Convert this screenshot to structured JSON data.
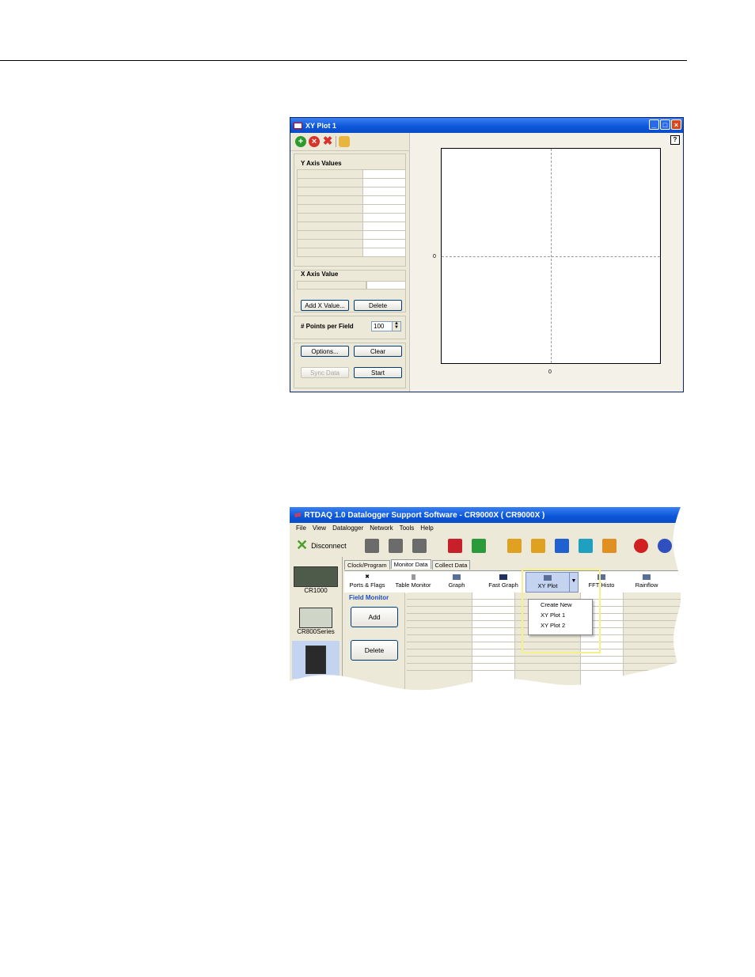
{
  "xy_window": {
    "title": "XY Plot 1",
    "toolbar_icons": [
      "add-icon",
      "remove-icon",
      "delete-icon",
      "hand-icon"
    ],
    "y_axis_label": "Y Axis Values",
    "x_axis_label": "X Axis Value",
    "add_x_value_button": "Add X Value...",
    "delete_button": "Delete",
    "points_per_field_label": "# Points per Field",
    "points_per_field_value": "100",
    "options_button": "Options...",
    "clear_button": "Clear",
    "sync_data_button": "Sync Data",
    "start_button": "Start",
    "help_button": "?",
    "plot_y_tick": "0",
    "plot_x_tick": "0"
  },
  "rtdaq_window": {
    "title": "RTDAQ 1.0 Datalogger Support Software - CR9000X ( CR9000X )",
    "menu": [
      "File",
      "View",
      "Datalogger",
      "Network",
      "Tools",
      "Help"
    ],
    "disconnect_button": "Disconnect",
    "devices": [
      {
        "label": "CR1000"
      },
      {
        "label": "CR800Series"
      }
    ],
    "tabs": [
      "Clock/Program",
      "Monitor Data",
      "Collect Data"
    ],
    "selected_tab": "Monitor Data",
    "ribbon": [
      "Ports & Flags",
      "Table Monitor",
      "Graph",
      "Fast Graph",
      "XY Plot",
      "FFT/Histo",
      "Rainflow"
    ],
    "dropdown_menu": [
      "Create New",
      "XY Plot 1",
      "XY Plot 2"
    ],
    "field_monitor_label": "Field Monitor",
    "add_button": "Add",
    "delete_button": "Delete"
  },
  "colors": {
    "titlebar": "#0b56d9",
    "window_bg": "#ece9d8",
    "highlight": "#f5f08a",
    "field_monitor_text": "#2050c0"
  }
}
